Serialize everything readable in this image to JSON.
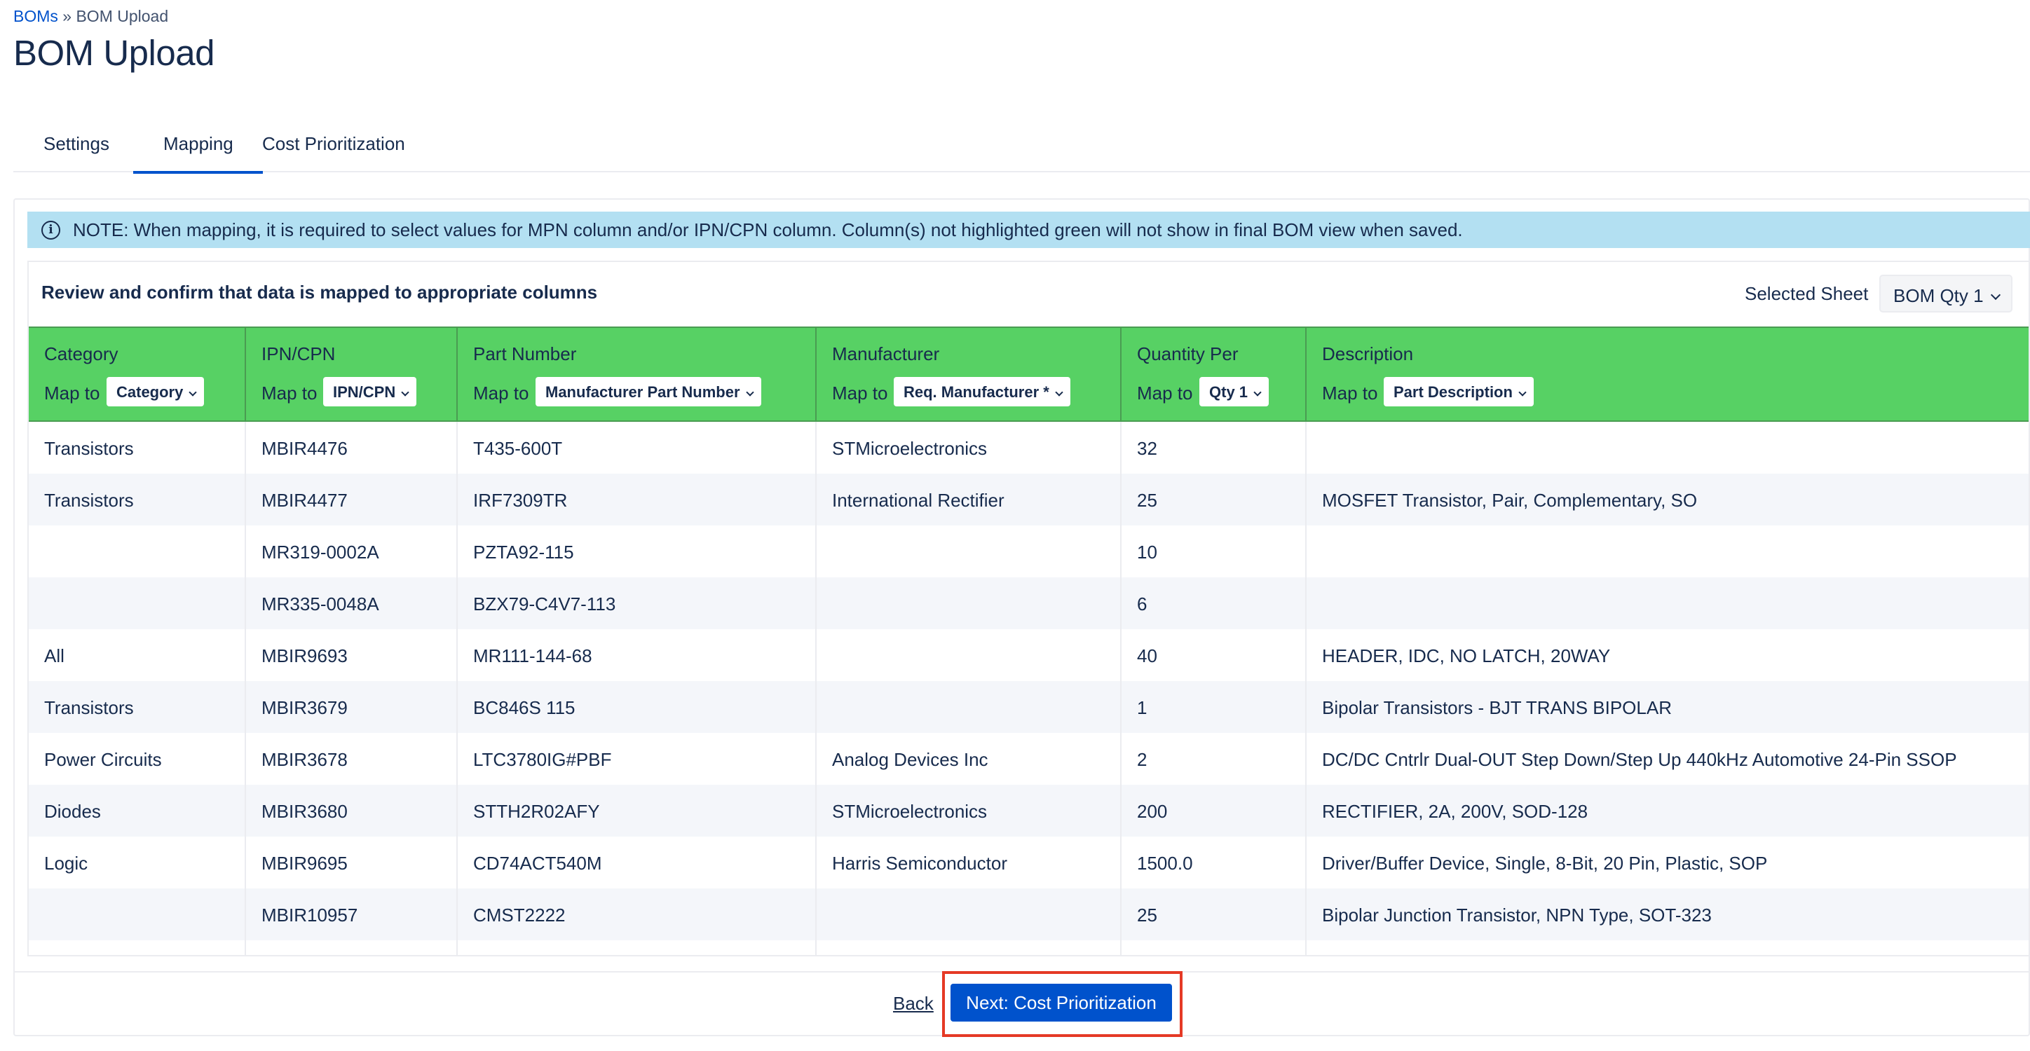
{
  "breadcrumb": {
    "root": "BOMs",
    "separator": "»",
    "current": "BOM Upload"
  },
  "page": {
    "title": "BOM Upload"
  },
  "tabs": [
    {
      "label": "Settings"
    },
    {
      "label": "Mapping",
      "active": true
    },
    {
      "label": "Cost Prioritization"
    }
  ],
  "note": {
    "icon": "info-icon",
    "text": "NOTE: When mapping, it is required to select values for MPN column and/or IPN/CPN column. Column(s) not highlighted green will not show in final BOM view when saved."
  },
  "review": {
    "text": "Review and confirm that data is mapped to appropriate columns"
  },
  "sheet": {
    "label": "Selected Sheet",
    "value": "BOM Qty 1"
  },
  "columns": [
    {
      "name": "Category",
      "map_label": "Map to",
      "map_value": "Category"
    },
    {
      "name": "IPN/CPN",
      "map_label": "Map to",
      "map_value": "IPN/CPN"
    },
    {
      "name": "Part Number",
      "map_label": "Map to",
      "map_value": "Manufacturer Part Number"
    },
    {
      "name": "Manufacturer",
      "map_label": "Map to",
      "map_value": "Req. Manufacturer *"
    },
    {
      "name": "Quantity Per",
      "map_label": "Map to",
      "map_value": "Qty 1"
    },
    {
      "name": "Description",
      "map_label": "Map to",
      "map_value": "Part Description"
    }
  ],
  "header_color": "#57d164",
  "rows": [
    [
      "Transistors",
      "MBIR4476",
      "T435-600T",
      "STMicroelectronics",
      "32",
      ""
    ],
    [
      "Transistors",
      "MBIR4477",
      "IRF7309TR",
      "International Rectifier",
      "25",
      "MOSFET Transistor, Pair, Complementary, SO"
    ],
    [
      "",
      "MR319-0002A",
      "PZTA92-115",
      "",
      "10",
      ""
    ],
    [
      "",
      "MR335-0048A",
      "BZX79-C4V7-113",
      "",
      "6",
      ""
    ],
    [
      "All",
      "MBIR9693",
      "MR111-144-68",
      "",
      "40",
      "HEADER, IDC, NO LATCH, 20WAY"
    ],
    [
      "Transistors",
      "MBIR3679",
      "BC846S 115",
      "",
      "1",
      "Bipolar Transistors - BJT TRANS BIPOLAR"
    ],
    [
      "Power Circuits",
      "MBIR3678",
      "LTC3780IG#PBF",
      "Analog Devices Inc",
      "2",
      "DC/DC Cntrlr Dual-OUT Step Down/Step Up 440kHz Automotive 24-Pin SSOP"
    ],
    [
      "Diodes",
      "MBIR3680",
      "STTH2R02AFY",
      "STMicroelectronics",
      "200",
      "RECTIFIER, 2A, 200V, SOD-128"
    ],
    [
      "Logic",
      "MBIR9695",
      "CD74ACT540M",
      "Harris Semiconductor",
      "1500.0",
      "Driver/Buffer Device, Single, 8-Bit, 20 Pin, Plastic, SOP"
    ],
    [
      "",
      "MBIR10957",
      "CMST2222",
      "",
      "25",
      "Bipolar Junction Transistor, NPN Type, SOT-323"
    ]
  ],
  "footer": {
    "back_label": "Back",
    "next_label": "Next: Cost Prioritization",
    "highlight_color": "#e53925"
  }
}
